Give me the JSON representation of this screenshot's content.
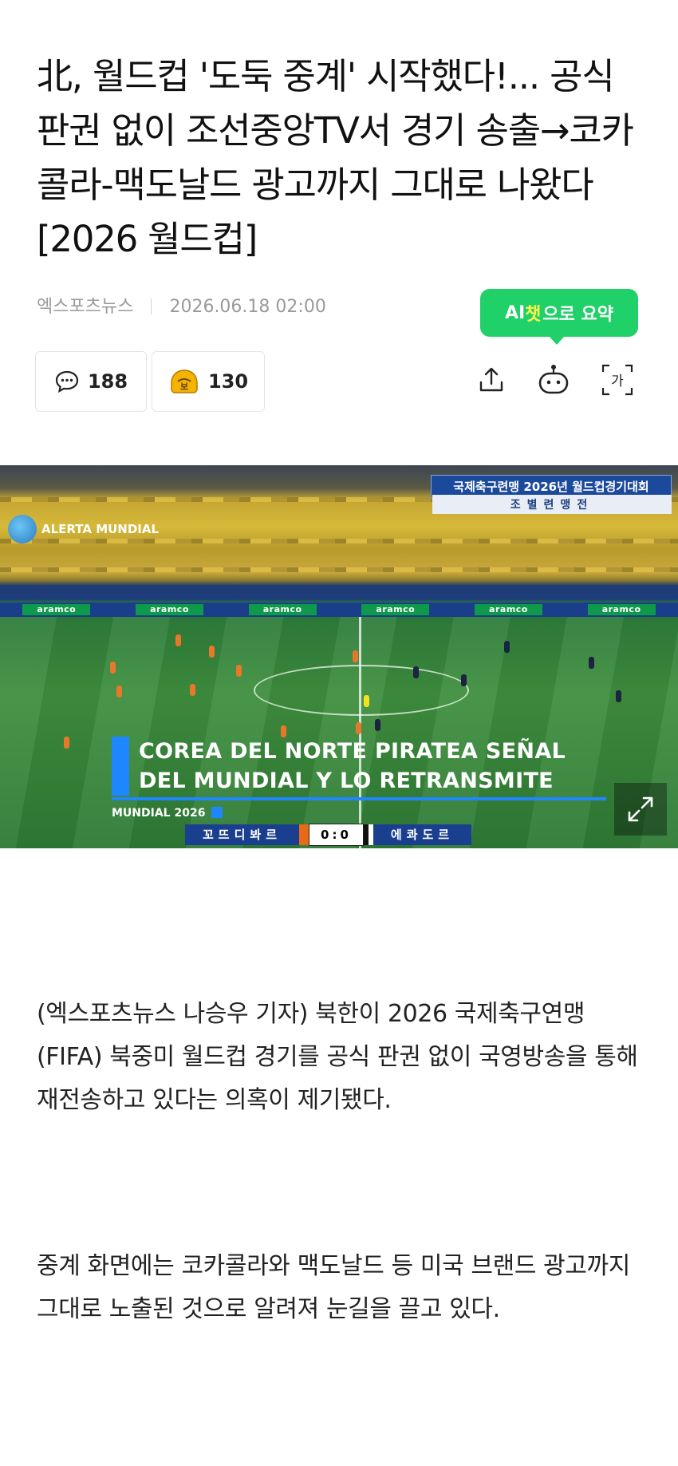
{
  "article": {
    "headline": "北, 월드컵 '도둑 중계' 시작했다!... 공식 판권 없이 조선중앙TV서 경기 송출→코카콜라-맥도날드 광고까지 그대로 나왔다 [2026 월드컵]",
    "source": "엑스포츠뉴스",
    "datetime": "2026.06.18 02:00",
    "paragraphs": [
      "(엑스포츠뉴스 나승우 기자) 북한이 2026 국제축구연맹(FIFA) 북중미 월드컵 경기를 공식 판권 없이 국영방송을 통해 재전송하고 있다는 의혹이 제기됐다.",
      "중계 화면에는 코카콜라와 맥도날드 등 미국 브랜드 광고까지 그대로 노출된 것으로 알려져 눈길을 끌고 있다."
    ]
  },
  "ai_summary": {
    "prefix": "AI",
    "chat": "챗",
    "suffix": "으로 요약"
  },
  "counts": {
    "comments": "188",
    "reactions": "130"
  },
  "reaction_icon_char": "보",
  "tools": {
    "share": "share-icon",
    "bot": "ai-bot-icon",
    "font": "가"
  },
  "photo": {
    "banner_title": "국제축구련맹 2026년 월드컵경기대회",
    "banner_sub": "조별련맹전",
    "channel_logo": "ALERTA MUNDIAL",
    "ad_text": "aramco",
    "caption_line1": "COREA DEL NORTE PIRATEA SEÑAL",
    "caption_line2": "DEL MUNDIAL Y LO RETRANSMITE",
    "mundial_label": "MUNDIAL 2026",
    "home_team": "꼬뜨디봐르",
    "score": "0:0",
    "away_team": "에콰도르"
  },
  "colors": {
    "ai_green": "#1fd168",
    "accent_blue": "#1e86ff",
    "reaction_yellow": "#f5b300"
  }
}
